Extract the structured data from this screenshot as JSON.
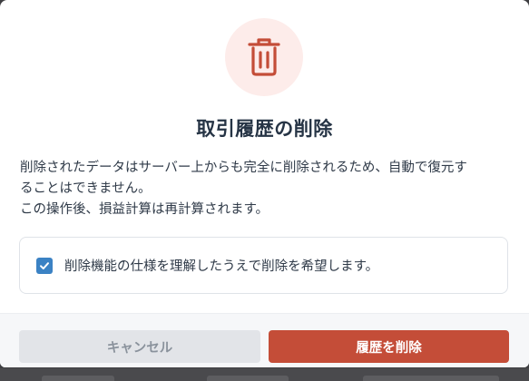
{
  "dialog": {
    "title": "取引履歴の削除",
    "description_lines": [
      "削除されたデータはサーバー上からも完全に削除されるため、自動で復元す",
      "ることはできません。",
      "この操作後、損益計算は再計算されます。"
    ],
    "confirm_checkbox": {
      "label": "削除機能の仕様を理解したうえで削除を希望します。",
      "checked": true
    },
    "buttons": {
      "cancel": "キャンセル",
      "delete": "履歴を削除"
    },
    "icon": "trash-icon"
  },
  "colors": {
    "accent_danger": "#c44d38",
    "icon_background": "#fdecea",
    "checkbox": "#3b82c4",
    "cancel_button_bg": "#e2e4e8"
  }
}
